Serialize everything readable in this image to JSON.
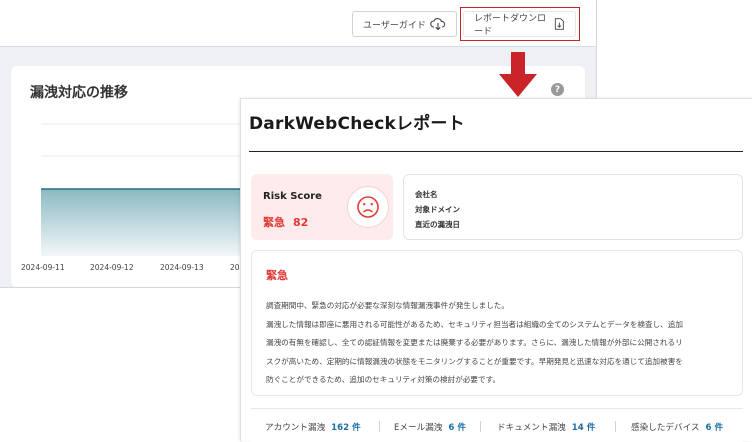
{
  "toolbar": {
    "user_guide_label": "ユーザーガイド",
    "report_download_label": "レポートダウンロード"
  },
  "trend_card": {
    "title": "漏洩対応の推移",
    "help": "?",
    "x_ticks": [
      "2024-09-11",
      "2024-09-12",
      "2024-09-13",
      "20"
    ]
  },
  "chart_data": {
    "type": "area",
    "x": [
      "2024-09-11",
      "2024-09-12",
      "2024-09-13"
    ],
    "series": [
      {
        "values": [
          1,
          1,
          1
        ]
      }
    ],
    "area_color": "#2d7f93"
  },
  "report": {
    "title": "DarkWebCheckレポート",
    "risk": {
      "label": "Risk Score",
      "level": "緊急",
      "score": "82"
    },
    "info": {
      "company": "会社名",
      "domain": "対象ドメイン",
      "recent_leak_date": "直近の漏洩日"
    },
    "summary": {
      "severity": "緊急",
      "lines": [
        "調査期間中、緊急の対応が必要な深刻な情報漏洩事件が発生しました。",
        "漏洩した情報は即座に悪用される可能性があるため、セキュリティ担当者は組織の全てのシステムとデータを検査し、追加",
        "漏洩の有無を確認し、全ての認証情報を変更または廃棄する必要があります。さらに、漏洩した情報が外部に公開されるリ",
        "スクが高いため、定期的に情報漏洩の状態をモニタリングすることが重要です。早期発見と迅速な対応を通じて追加被害を",
        "防ぐことができるため、追加のセキュリティ対策の検討が必要です。"
      ]
    },
    "stats": [
      {
        "label": "アカウント漏洩",
        "value": "162 件"
      },
      {
        "label": "Eメール漏洩",
        "value": "6 件"
      },
      {
        "label": "ドキュメント漏洩",
        "value": "14 件"
      },
      {
        "label": "感染したデバイス",
        "value": "6 件"
      }
    ]
  },
  "colors": {
    "highlight": "#c9242a",
    "danger": "#e03b35",
    "accent_blue": "#1c6ea4"
  }
}
